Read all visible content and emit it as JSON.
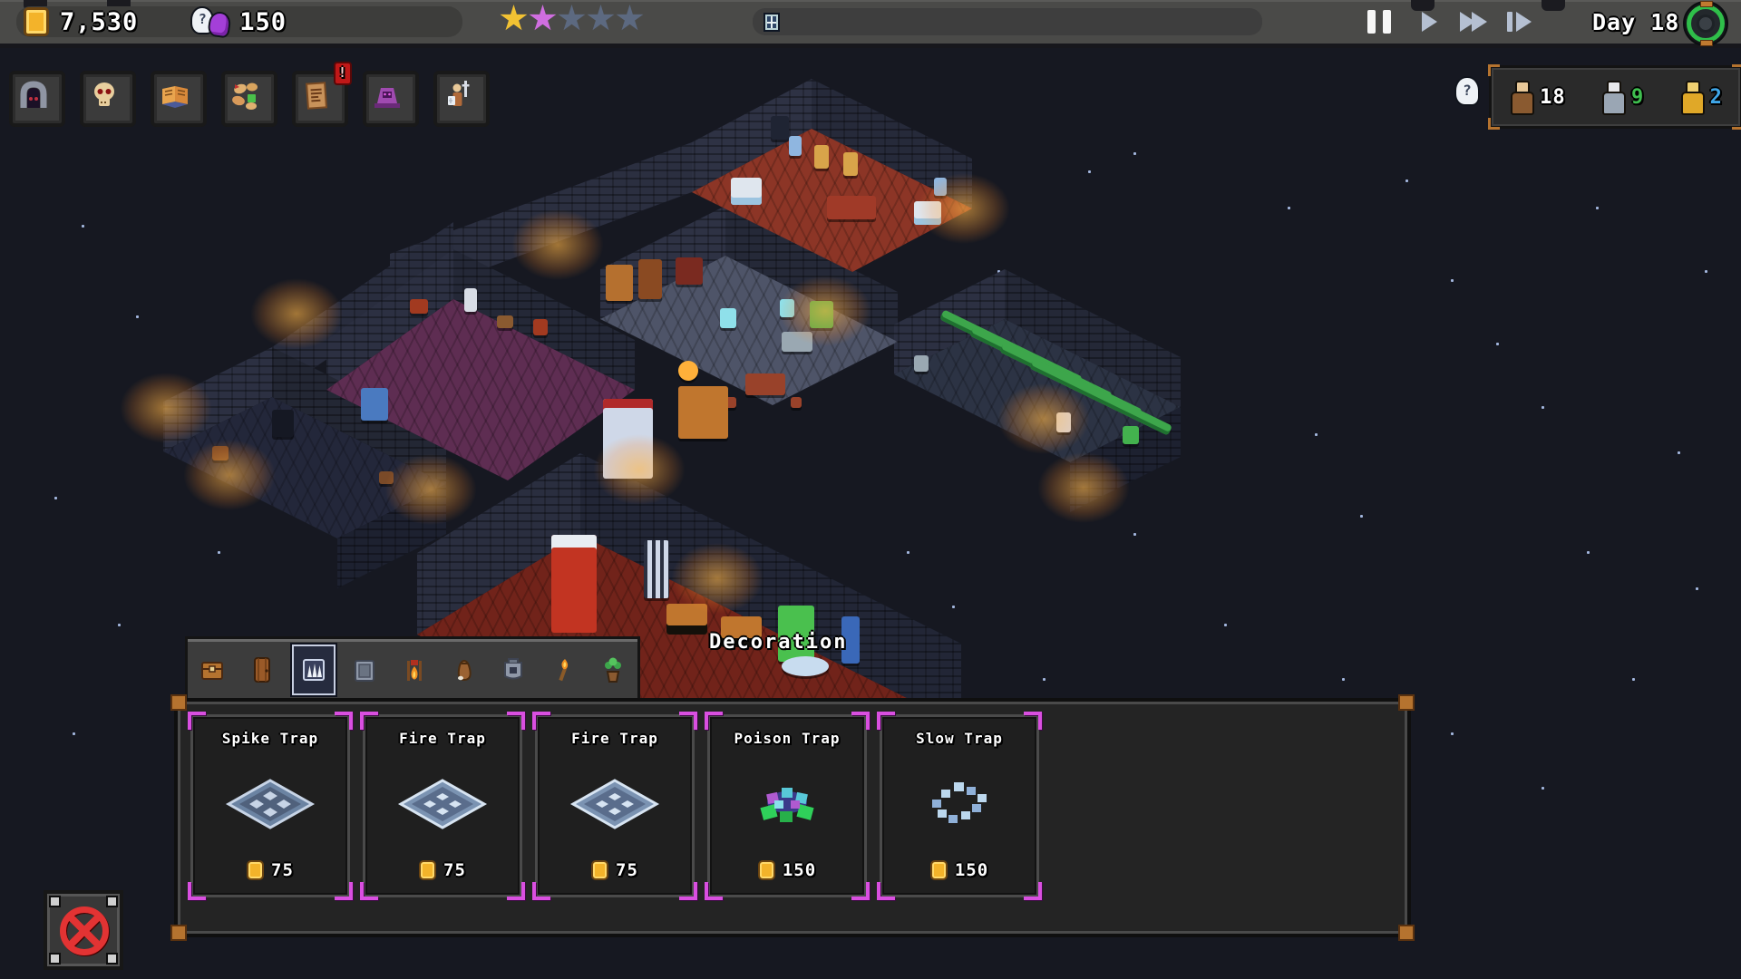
{
  "colors": {
    "accent_magenta": "#d94fe0",
    "gold": "#f3b32a",
    "star_gold": "#f2c233",
    "star_purple": "#d06ee0",
    "star_empty": "#5c6980",
    "worker_white": "#ffffff",
    "worker_green": "#3fbf4f",
    "worker_blue": "#3fa6e8",
    "danger_red": "#e23333",
    "portal_green": "#2fbf4a"
  },
  "icons": {
    "help_glyph": "?"
  },
  "hud": {
    "gold": "7,530",
    "souls": "150",
    "stars": [
      "gold",
      "purple",
      "empty",
      "empty",
      "empty"
    ],
    "day_label": "Day 18"
  },
  "toolbar": {
    "items": [
      {
        "icon": "dungeon-gate-icon"
      },
      {
        "icon": "skull-icon"
      },
      {
        "icon": "book-icon"
      },
      {
        "icon": "supplies-icon"
      },
      {
        "icon": "contract-icon",
        "badge": "!"
      },
      {
        "icon": "altar-icon"
      },
      {
        "icon": "hero-icon"
      }
    ]
  },
  "workers": {
    "items": [
      {
        "icon": "worker-brown-icon",
        "count": "18"
      },
      {
        "icon": "worker-gray-icon",
        "count": "9"
      },
      {
        "icon": "worker-gold-icon",
        "count": "2"
      }
    ]
  },
  "build_panel": {
    "selected_tab_index": 2,
    "tabs": [
      {
        "icon": "chest-icon"
      },
      {
        "icon": "door-icon"
      },
      {
        "icon": "spike-trap-icon"
      },
      {
        "icon": "stone-plate-icon"
      },
      {
        "icon": "campfire-icon"
      },
      {
        "icon": "sack-icon"
      },
      {
        "icon": "furnace-icon"
      },
      {
        "icon": "torch-icon"
      },
      {
        "icon": "plant-icon"
      }
    ],
    "cards": [
      {
        "name": "Spike Trap",
        "price": "75",
        "icon": "spike-plate-icon"
      },
      {
        "name": "Fire Trap",
        "price": "75",
        "icon": "fire-plate-icon"
      },
      {
        "name": "Fire Trap",
        "price": "75",
        "icon": "fire-plate-icon"
      },
      {
        "name": "Poison Trap",
        "price": "150",
        "icon": "poison-trap-icon"
      },
      {
        "name": "Slow Trap",
        "price": "150",
        "icon": "slow-trap-icon"
      }
    ]
  },
  "tooltip": {
    "label": "Decoration"
  }
}
